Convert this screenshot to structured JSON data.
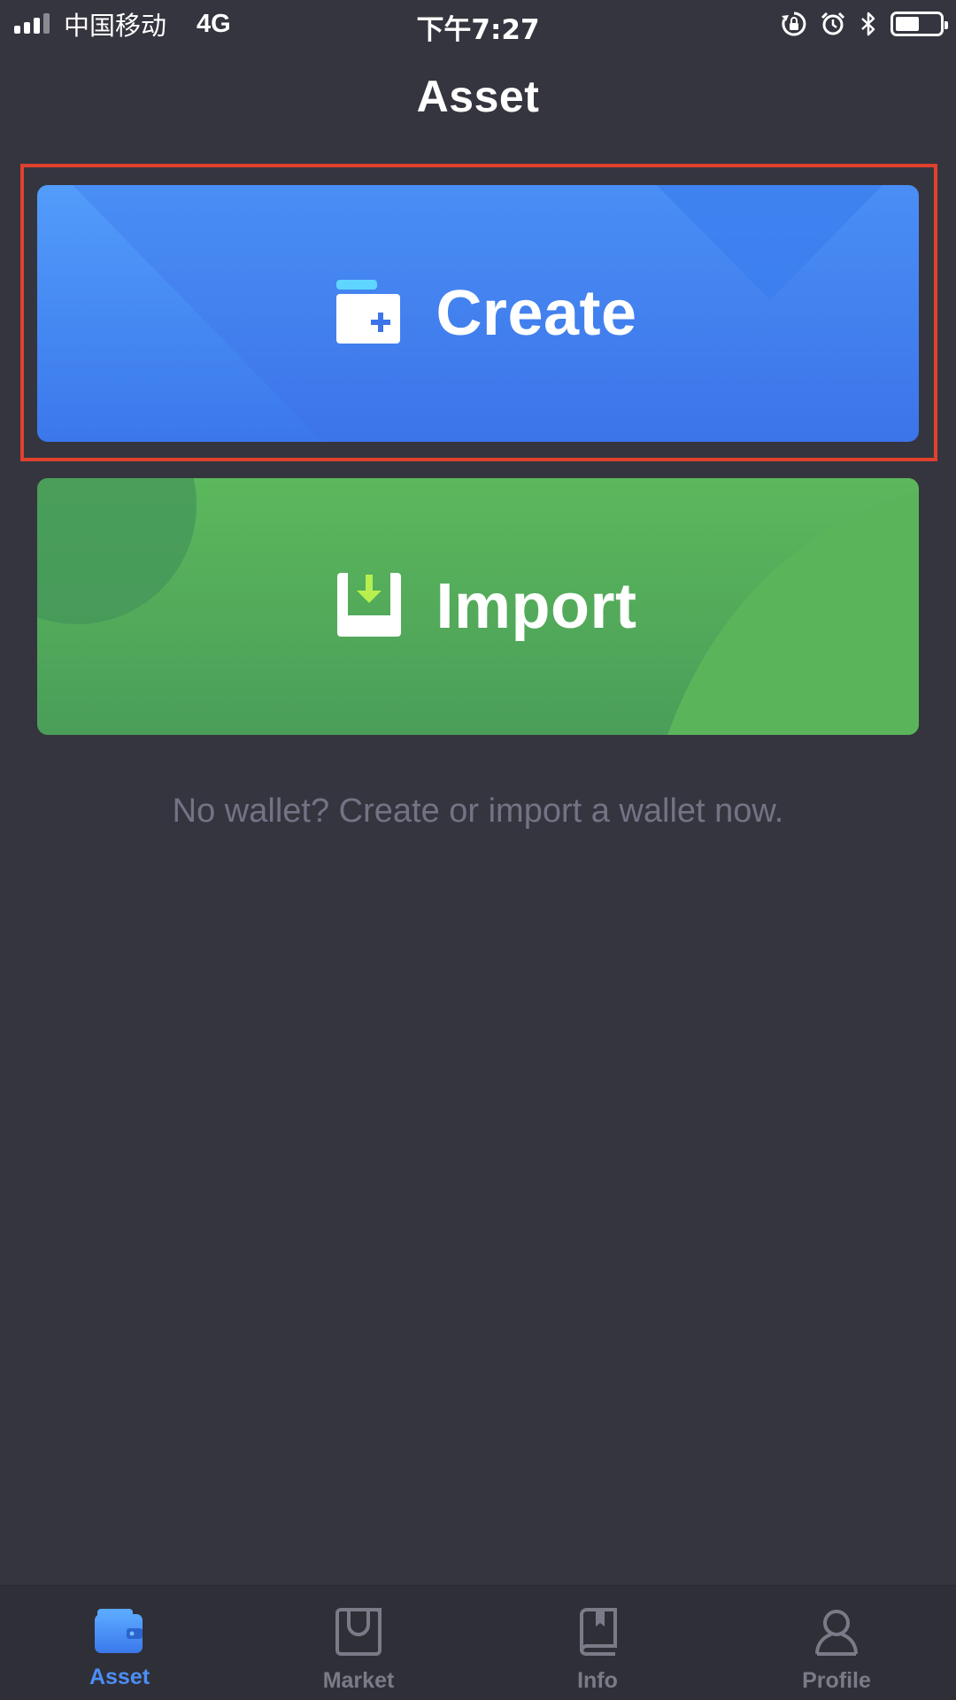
{
  "status_bar": {
    "carrier": "中国移动",
    "network": "4G",
    "time": "下午7:27",
    "battery_level": 0.55
  },
  "header": {
    "title": "Asset"
  },
  "actions": {
    "create_label": "Create",
    "import_label": "Import"
  },
  "hint": "No wallet?  Create or import a wallet now.",
  "tabs": [
    {
      "label": "Asset",
      "icon": "wallet-icon",
      "active": true
    },
    {
      "label": "Market",
      "icon": "shopping-bag-icon",
      "active": false
    },
    {
      "label": "Info",
      "icon": "book-icon",
      "active": false
    },
    {
      "label": "Profile",
      "icon": "person-icon",
      "active": false
    }
  ],
  "colors": {
    "background": "#35353f",
    "create_card": "#4485f2",
    "import_card": "#55b05a",
    "highlight": "#e0412e",
    "active_tab": "#4c8ef7",
    "inactive_tab": "#7b7b88"
  }
}
